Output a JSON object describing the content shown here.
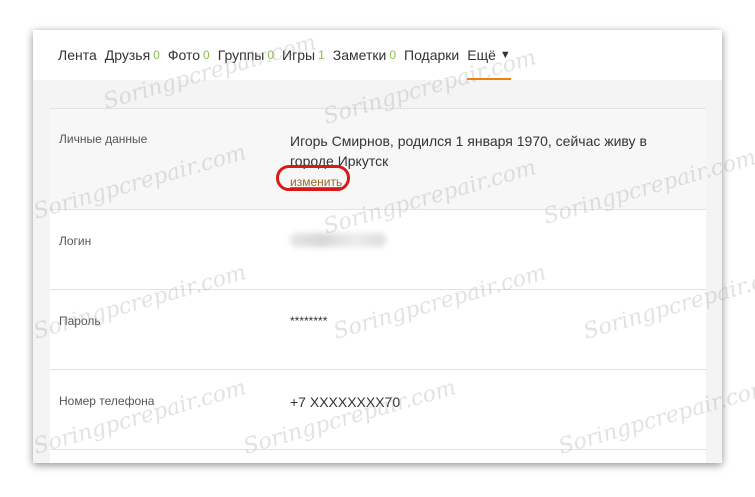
{
  "nav": {
    "items": [
      {
        "label": "Лента",
        "count": ""
      },
      {
        "label": "Друзья",
        "count": "0"
      },
      {
        "label": "Фото",
        "count": "0"
      },
      {
        "label": "Группы",
        "count": "0"
      },
      {
        "label": "Игры",
        "count": "1"
      },
      {
        "label": "Заметки",
        "count": "0"
      },
      {
        "label": "Подарки",
        "count": ""
      },
      {
        "label": "Ещё",
        "count": ""
      }
    ],
    "active_index": 7,
    "accent_color": "#ee8208",
    "count_color": "#8cbc53"
  },
  "settings": {
    "personal": {
      "label": "Личные данные",
      "value": "Игорь Смирнов, родился 1 января 1970, сейчас живу в городе Иркутск",
      "change_link": "изменить"
    },
    "login": {
      "label": "Логин"
    },
    "password": {
      "label": "Пароль",
      "value": "********"
    },
    "phone": {
      "label": "Номер телефона",
      "value": "+7 XXXXXXXX70"
    }
  },
  "watermark": "Soringpcrepair.com",
  "highlight_color": "#d91818"
}
